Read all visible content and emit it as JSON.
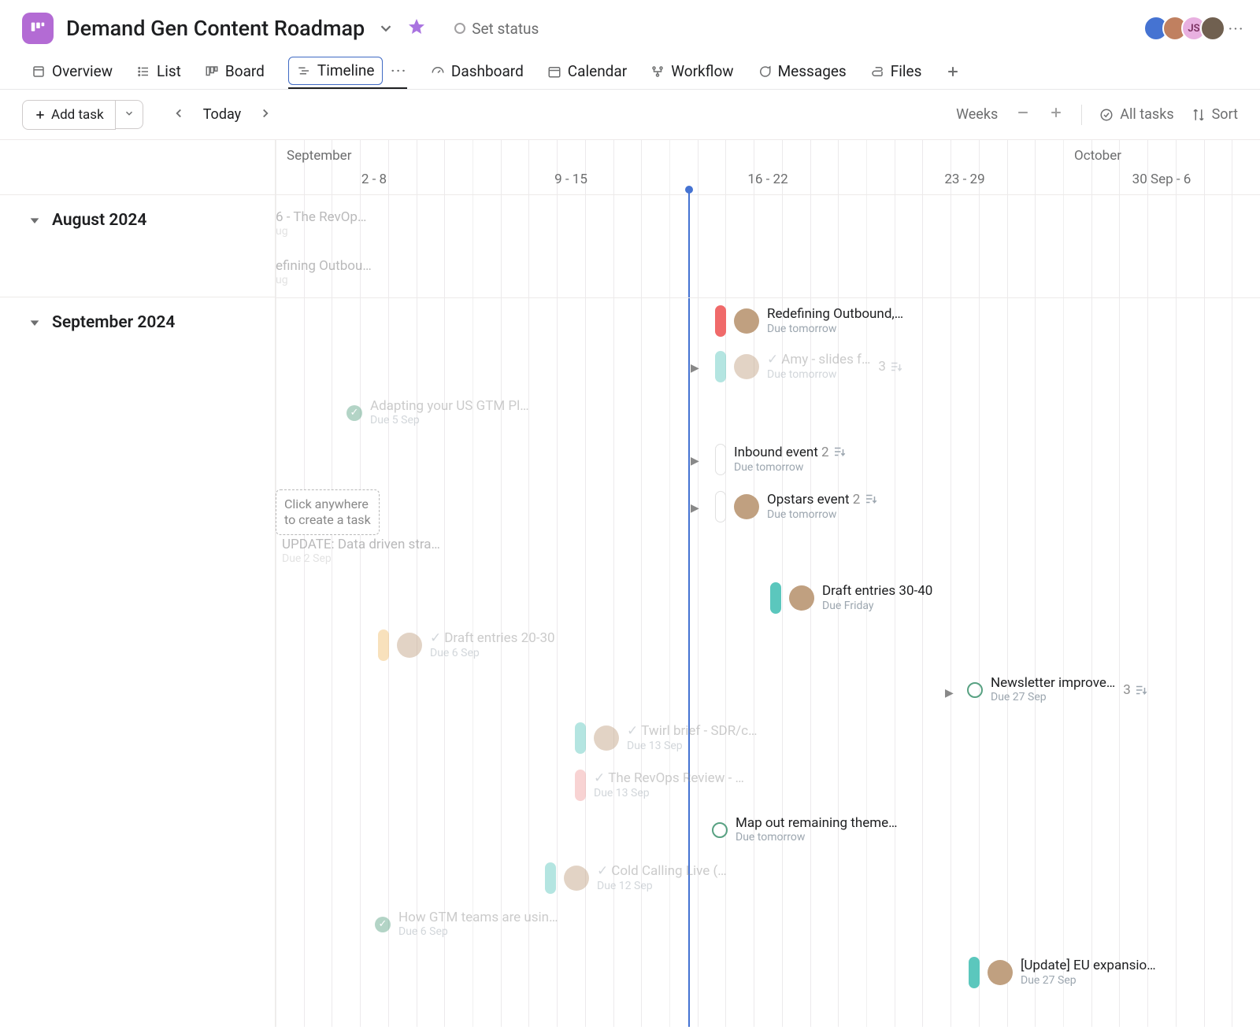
{
  "header": {
    "project_title": "Demand Gen Content Roadmap",
    "set_status": "Set status",
    "avatar_initials": "JS",
    "more": "···"
  },
  "tabs": {
    "overview": "Overview",
    "list": "List",
    "board": "Board",
    "timeline": "Timeline",
    "dashboard": "Dashboard",
    "calendar": "Calendar",
    "workflow": "Workflow",
    "messages": "Messages",
    "files": "Files",
    "opts": "···"
  },
  "toolbar": {
    "add_task": "Add task",
    "today": "Today",
    "weeks": "Weeks",
    "all_tasks": "All tasks",
    "sort": "Sort"
  },
  "timeline_header": {
    "month1": "September",
    "month2": "October",
    "ranges": [
      "2 - 8",
      "9 - 15",
      "16 - 22",
      "23 - 29",
      "30 Sep - 6"
    ]
  },
  "sections": {
    "s1": "August 2024",
    "s2": "September 2024"
  },
  "hint": {
    "line1": "Click anywhere",
    "line2": "to create a task"
  },
  "tasks": {
    "revops6": {
      "title": "6 - The RevOp…",
      "due": "ug"
    },
    "redef_out_stub": {
      "title": "efining Outbou…",
      "due": "ug"
    },
    "redef_out": {
      "title": "Redefining Outbound,…",
      "due": "Due tomorrow"
    },
    "amy_slides": {
      "title": "Amy - slides f…",
      "due": "Due tomorrow",
      "count": "3"
    },
    "adapting": {
      "title": "Adapting your US GTM Pl…",
      "due": "Due 5 Sep"
    },
    "inbound": {
      "title": "Inbound event",
      "due": "Due tomorrow",
      "count": "2"
    },
    "opstars": {
      "title": "Opstars event",
      "due": "Due tomorrow",
      "count": "2"
    },
    "update_data": {
      "title": "UPDATE: Data driven stra…",
      "due": "Due 2 Sep"
    },
    "draft3040": {
      "title": "Draft entries 30-40",
      "due": "Due Friday"
    },
    "draft2030": {
      "title": "Draft entries 20-30",
      "due": "Due 6 Sep"
    },
    "newsletter": {
      "title": "Newsletter improve…",
      "due": "Due 27 Sep",
      "count": "3"
    },
    "twirl": {
      "title": "Twirl brief - SDR/c…",
      "due": "Due 13 Sep"
    },
    "revops_review": {
      "title": "The RevOps Review - …",
      "due": "Due 13 Sep"
    },
    "mapout": {
      "title": "Map out remaining theme…",
      "due": "Due tomorrow"
    },
    "coldcall": {
      "title": "Cold Calling Live (…",
      "due": "Due 12 Sep"
    },
    "gtm_teams": {
      "title": "How GTM teams are usin…",
      "due": "Due 6 Sep"
    },
    "eu_expansion": {
      "title": "[Update] EU expansio…",
      "due": "Due 27 Sep"
    }
  }
}
